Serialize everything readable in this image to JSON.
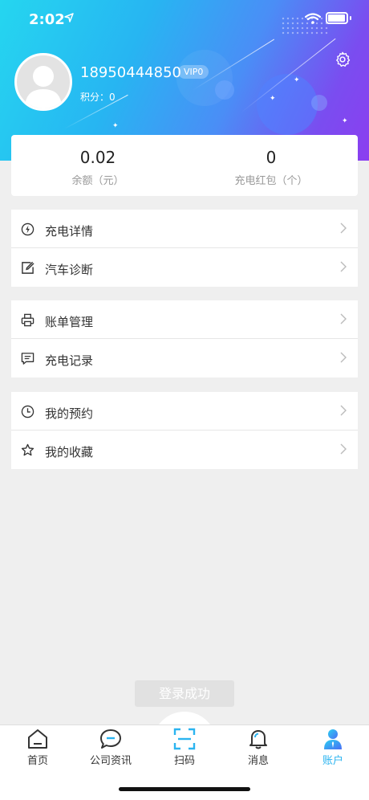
{
  "status_bar": {
    "time": "2:02"
  },
  "profile": {
    "phone": "18950444850",
    "vip_badge": "VIP0",
    "points_label": "积分：",
    "points_value": "0"
  },
  "balance": {
    "amount_value": "0.02",
    "amount_label": "余额（元）",
    "redpacket_value": "0",
    "redpacket_label": "充电红包（个）"
  },
  "menu_groups": [
    {
      "items": [
        {
          "label": "充电详情",
          "icon": "lightning-icon"
        },
        {
          "label": "汽车诊断",
          "icon": "edit-icon"
        }
      ]
    },
    {
      "items": [
        {
          "label": "账单管理",
          "icon": "printer-icon"
        },
        {
          "label": "充电记录",
          "icon": "message-icon"
        }
      ]
    },
    {
      "items": [
        {
          "label": "我的预约",
          "icon": "clock-icon"
        },
        {
          "label": "我的收藏",
          "icon": "star-icon"
        }
      ]
    }
  ],
  "toast": "登录成功",
  "tabbar": {
    "items": [
      {
        "label": "首页",
        "icon": "home-icon"
      },
      {
        "label": "公司资讯",
        "icon": "chat-icon"
      },
      {
        "label": "扫码",
        "icon": "scan-icon"
      },
      {
        "label": "消息",
        "icon": "bell-icon"
      },
      {
        "label": "账户",
        "icon": "user-icon"
      }
    ],
    "active_index": 4
  },
  "colors": {
    "accent": "#2bb4f0",
    "header_start": "#25d6f0",
    "header_end": "#8b3ef0"
  }
}
